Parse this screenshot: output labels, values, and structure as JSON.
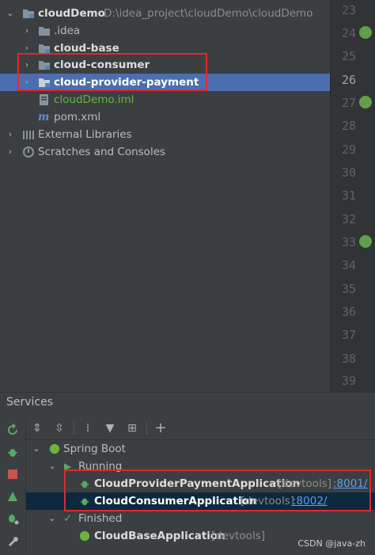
{
  "project": {
    "root": {
      "name": "cloudDemo",
      "path": "D:\\idea_project\\cloudDemo\\cloudDemo"
    },
    "items": [
      {
        "label": ".idea"
      },
      {
        "label": "cloud-base"
      },
      {
        "label": "cloud-consumer"
      },
      {
        "label": "cloud-provider-payment"
      },
      {
        "label": "cloudDemo.iml"
      },
      {
        "label": "pom.xml"
      }
    ],
    "external": "External Libraries",
    "scratches": "Scratches and Consoles"
  },
  "gutter": {
    "lines": [
      "23",
      "24",
      "25",
      "26",
      "27",
      "28",
      "29",
      "30",
      "31",
      "32",
      "33",
      "34",
      "35",
      "36",
      "37",
      "38",
      "39"
    ],
    "current_line": "26"
  },
  "services": {
    "title": "Services",
    "tree": {
      "spring_boot": "Spring Boot",
      "running": "Running",
      "finished": "Finished",
      "apps": [
        {
          "name": "CloudProviderPaymentApplication",
          "tag": "[devtools]",
          "port": ":8001/"
        },
        {
          "name": "CloudConsumerApplication",
          "tag": "[devtools]",
          "port": ":8002/"
        },
        {
          "name": "CloudBaseApplication",
          "tag": "[devtools]"
        }
      ]
    }
  },
  "watermark": "CSDN @java-zh",
  "colors": {
    "selection": "#4b6eaf",
    "highlight_box": "#e0282e",
    "link": "#589df6",
    "module_green": "#62b543"
  }
}
